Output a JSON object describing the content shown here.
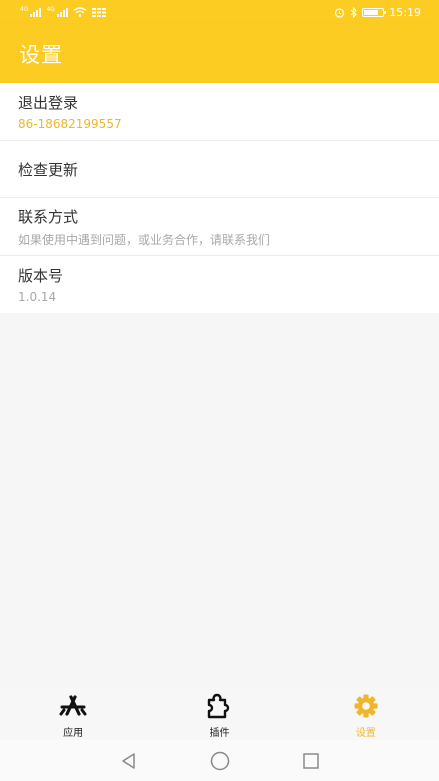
{
  "status_bar": {
    "signal_label_1": "4G",
    "signal_label_2": "4G",
    "time": "15:19",
    "battery_level": 0.75
  },
  "app_bar": {
    "title": "设置"
  },
  "settings": {
    "items": [
      {
        "title": "退出登录",
        "subtitle": "86-18682199557",
        "subtitle_style": "accent"
      },
      {
        "title": "检查更新",
        "subtitle": ""
      },
      {
        "title": "联系方式",
        "subtitle": "如果使用中遇到问题，或业务合作，请联系我们"
      },
      {
        "title": "版本号",
        "subtitle": "1.0.14"
      }
    ]
  },
  "bottom_nav": {
    "tabs": [
      {
        "label": "应用",
        "icon": "app-store-icon",
        "active": false
      },
      {
        "label": "插件",
        "icon": "puzzle-icon",
        "active": false
      },
      {
        "label": "设置",
        "icon": "gear-icon",
        "active": true
      }
    ]
  },
  "colors": {
    "primary": "#fdcc22",
    "accent_text": "#f0b62a",
    "background": "#f6f6f6"
  },
  "system_nav": {
    "icons": [
      "back-icon",
      "home-icon",
      "recents-icon"
    ]
  }
}
